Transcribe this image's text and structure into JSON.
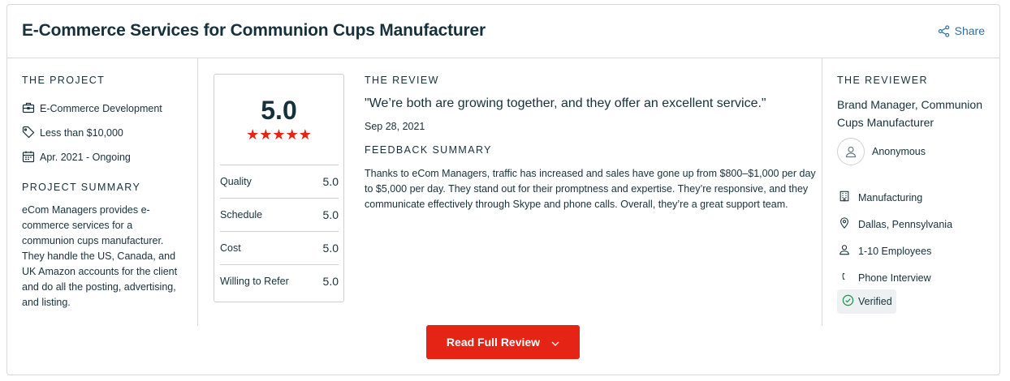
{
  "header": {
    "title": "E-Commerce Services for Communion Cups Manufacturer",
    "share_label": "Share"
  },
  "project": {
    "section_title": "THE PROJECT",
    "service": "E-Commerce Development",
    "budget": "Less than $10,000",
    "timeline": "Apr. 2021 - Ongoing",
    "summary_title": "PROJECT SUMMARY",
    "summary": "eCom Managers provides e-commerce services for a communion cups manufacturer. They handle the US, Canada, and UK Amazon accounts for the client and do all the posting, advertising, and listing."
  },
  "scores": {
    "overall": "5.0",
    "stars": "★★★★★",
    "rating_stars": 5,
    "rows": [
      {
        "label": "Quality",
        "value": "5.0"
      },
      {
        "label": "Schedule",
        "value": "5.0"
      },
      {
        "label": "Cost",
        "value": "5.0"
      },
      {
        "label": "Willing to Refer",
        "value": "5.0"
      }
    ]
  },
  "review": {
    "section_title": "THE REVIEW",
    "quote": "\"We’re both are growing together, and they offer an excellent service.\"",
    "date": "Sep 28, 2021",
    "feedback_title": "FEEDBACK SUMMARY",
    "feedback": "Thanks to eCom Managers, traffic has increased and sales have gone up from $800–$1,000 per day to $5,000 per day. They stand out for their promptness and expertise. They’re responsive, and they communicate effectively through Skype and phone calls. Overall, they’re a great support team."
  },
  "reviewer": {
    "section_title": "THE REVIEWER",
    "role": "Brand Manager, Communion Cups Manufacturer",
    "name": "Anonymous",
    "industry": "Manufacturing",
    "location": "Dallas, Pennsylvania",
    "size": "1-10 Employees",
    "interview": "Phone Interview",
    "verified": "Verified"
  },
  "actions": {
    "read_full_review": "Read Full Review"
  },
  "colors": {
    "accent_red": "#e62415",
    "link_blue": "#2f6ea0",
    "text_dark": "#17313b"
  }
}
